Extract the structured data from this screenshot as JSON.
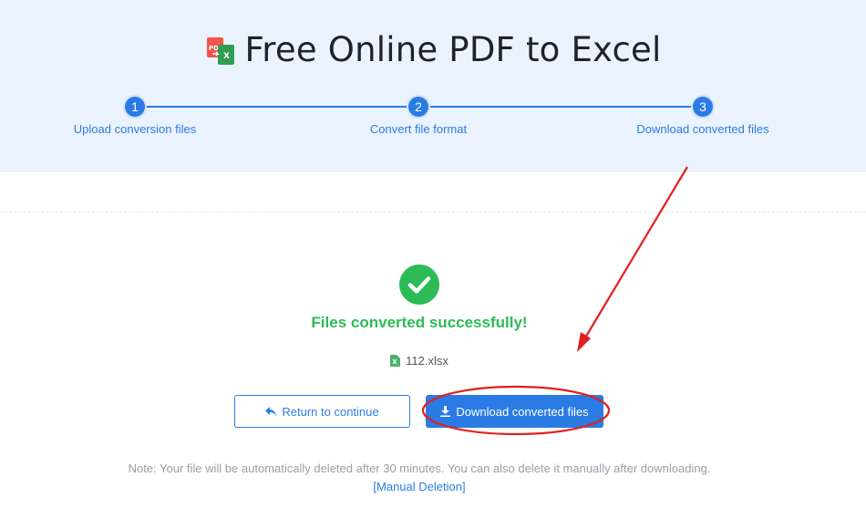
{
  "header": {
    "title": "Free Online PDF to Excel",
    "icon": "pdf-to-excel-icon"
  },
  "stepper": {
    "steps": [
      {
        "number": "1",
        "label": "Upload conversion files"
      },
      {
        "number": "2",
        "label": "Convert file format"
      },
      {
        "number": "3",
        "label": "Download converted files"
      }
    ]
  },
  "result": {
    "icon": "check-circle-icon",
    "message": "Files converted successfully!",
    "file_icon": "excel-file-icon",
    "file_name": "112.xlsx"
  },
  "actions": {
    "return_label": "Return to continue",
    "return_icon": "reply-arrow-icon",
    "download_label": "Download converted files",
    "download_icon": "download-icon"
  },
  "footer": {
    "note": "Note: Your file will be automatically deleted after 30 minutes. You can also delete it manually after downloading.",
    "manual_deletion": "[Manual Deletion]"
  },
  "colors": {
    "accent": "#2b7be4",
    "success": "#2dbb55",
    "hero_bg": "#eaf3fd",
    "annotation": "#e0201f"
  }
}
